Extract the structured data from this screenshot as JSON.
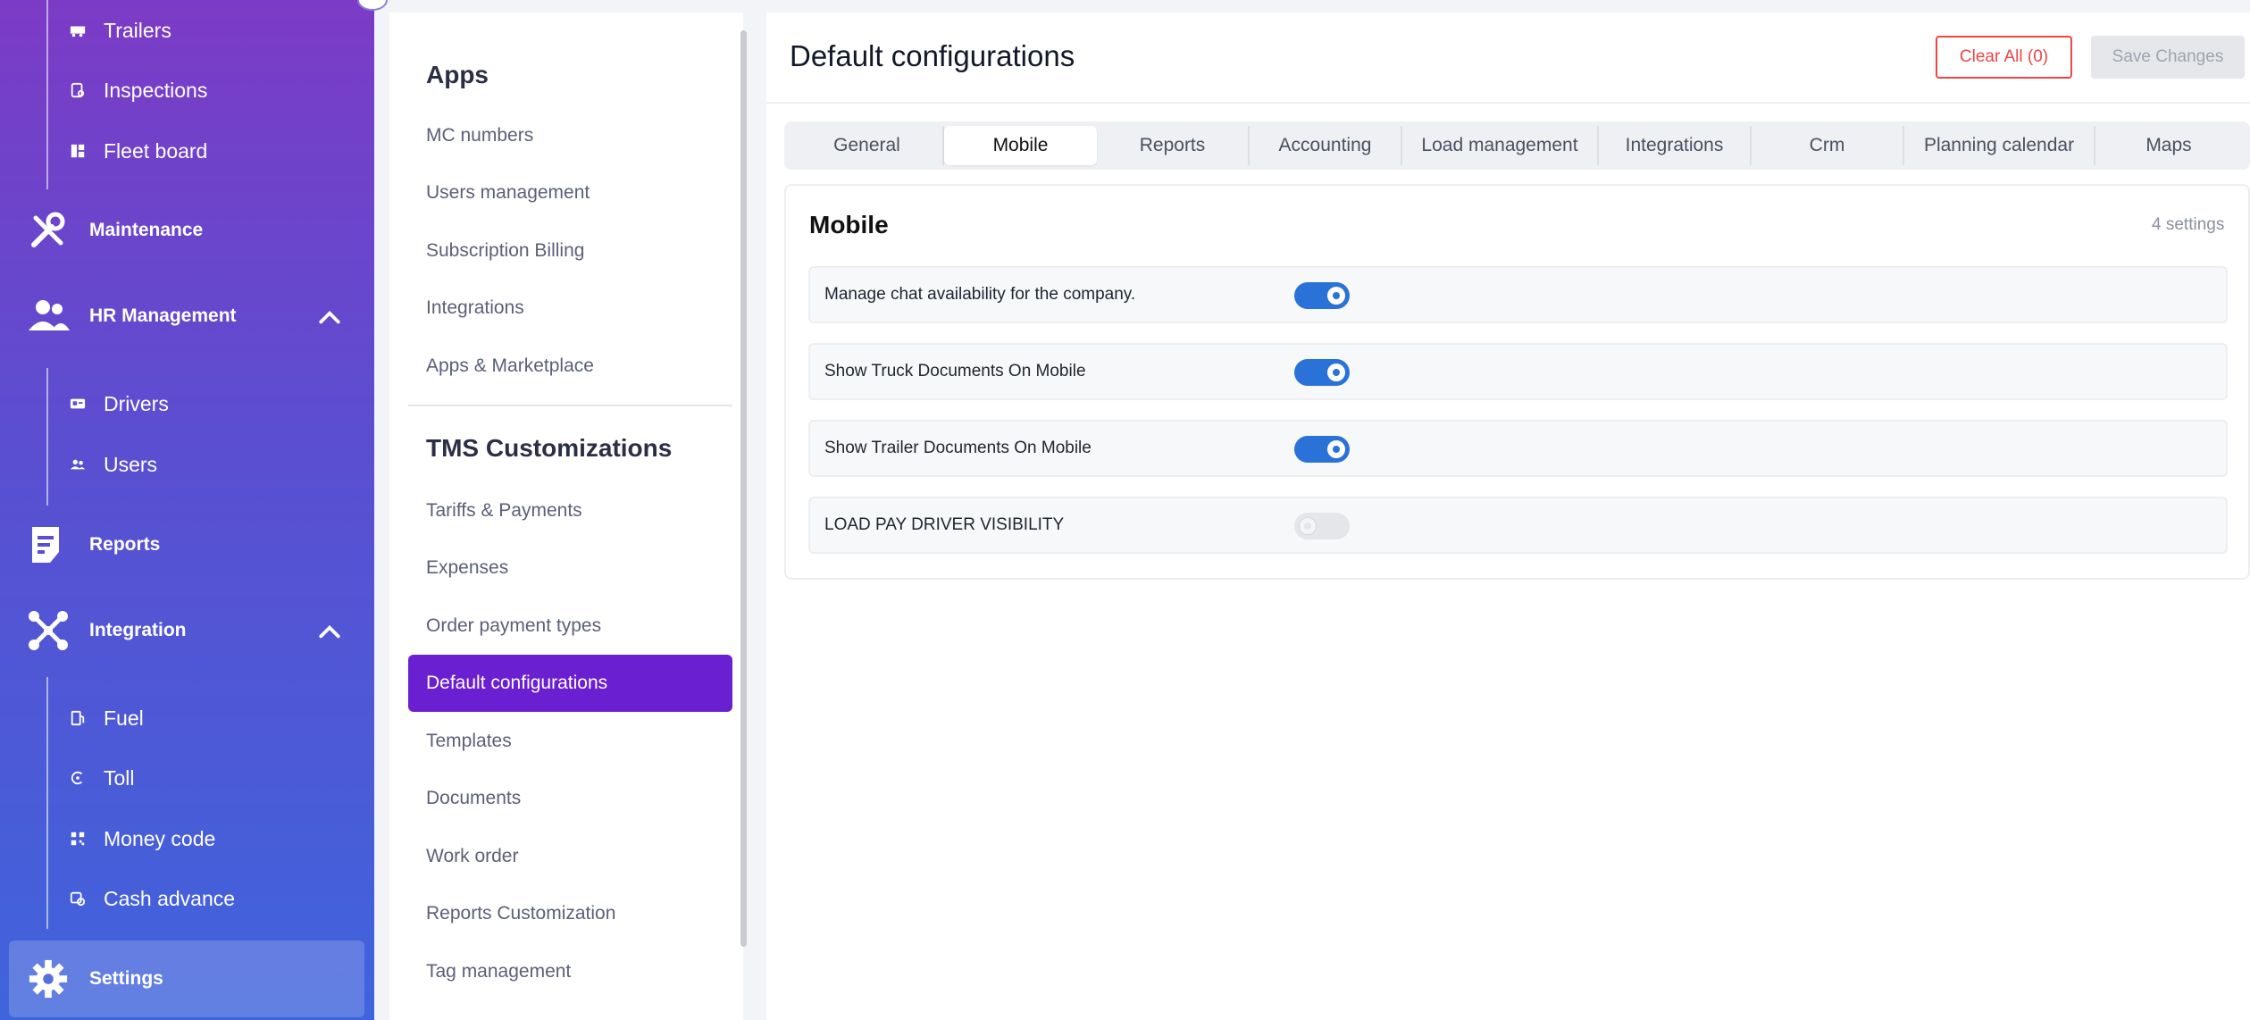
{
  "sidebar": {
    "top_sub_items": [
      {
        "label": "Trailers",
        "icon": "trailer-icon"
      },
      {
        "label": "Inspections",
        "icon": "inspection-icon"
      },
      {
        "label": "Fleet board",
        "icon": "fleet-board-icon"
      }
    ],
    "maintenance": {
      "label": "Maintenance",
      "icon": "wrench-screwdriver-icon"
    },
    "hr": {
      "label": "HR Management",
      "icon": "people-icon",
      "items": [
        {
          "label": "Drivers",
          "icon": "id-card-icon"
        },
        {
          "label": "Users",
          "icon": "users-icon"
        }
      ]
    },
    "reports": {
      "label": "Reports",
      "icon": "report-icon"
    },
    "integration": {
      "label": "Integration",
      "icon": "integration-icon",
      "items": [
        {
          "label": "Fuel",
          "icon": "fuel-icon"
        },
        {
          "label": "Toll",
          "icon": "toll-icon"
        },
        {
          "label": "Money code",
          "icon": "qr-code-icon"
        },
        {
          "label": "Cash advance",
          "icon": "cash-advance-icon"
        }
      ]
    },
    "settings": {
      "label": "Settings",
      "icon": "gear-icon"
    }
  },
  "settings_menu": {
    "apps_heading": "Apps",
    "apps_items": [
      "MC numbers",
      "Users management",
      "Subscription Billing",
      "Integrations",
      "Apps & Marketplace"
    ],
    "tms_heading": "TMS Customizations",
    "tms_items": [
      "Tariffs & Payments",
      "Expenses",
      "Order payment types",
      "Default configurations",
      "Templates",
      "Documents",
      "Work order",
      "Reports Customization",
      "Tag management"
    ],
    "active_item": "Default configurations"
  },
  "main": {
    "title": "Default configurations",
    "clear_all_label": "Clear All (0)",
    "save_label": "Save Changes",
    "tabs": [
      "General",
      "Mobile",
      "Reports",
      "Accounting",
      "Load management",
      "Integrations",
      "Crm",
      "Planning calendar",
      "Maps"
    ],
    "active_tab": "Mobile",
    "section": {
      "title": "Mobile",
      "count": "4 settings",
      "settings": [
        {
          "label": "Manage chat availability for the company.",
          "enabled": true
        },
        {
          "label": "Show Truck Documents On Mobile",
          "enabled": true
        },
        {
          "label": "Show Trailer Documents On Mobile",
          "enabled": true
        },
        {
          "label": "LOAD PAY DRIVER VISIBILITY",
          "enabled": false
        }
      ]
    }
  },
  "colors": {
    "accent_purple": "#6a1fd0",
    "toggle_on": "#2a72d8",
    "danger": "#ef4444"
  }
}
